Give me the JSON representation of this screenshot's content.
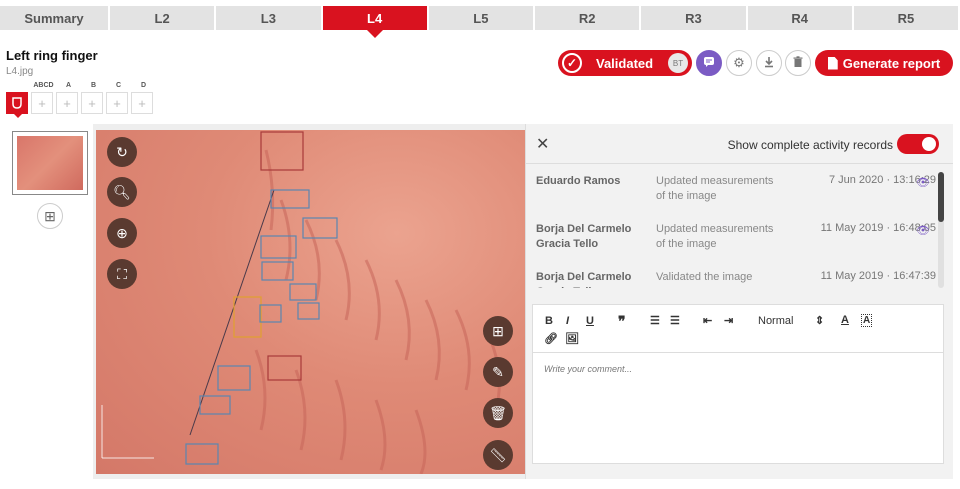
{
  "tabs": [
    "Summary",
    "L2",
    "L3",
    "L4",
    "L5",
    "R2",
    "R3",
    "R4",
    "R5"
  ],
  "active_tab": "L4",
  "finger": {
    "title": "Left ring finger",
    "filename": "L4.jpg"
  },
  "grid": {
    "labels": [
      "ABCD",
      "A",
      "B",
      "C",
      "D"
    ]
  },
  "status": {
    "label": "Validated",
    "initials": "BT"
  },
  "actions": {
    "generate_report": "Generate report"
  },
  "activity": {
    "show_label": "Show complete activity records",
    "records": [
      {
        "user": "Eduardo Ramos",
        "action": "Updated measurements of the image",
        "date": "7 Jun 2020 · 13:16:29"
      },
      {
        "user": "Borja Del Carmelo Gracia Tello",
        "action": "Updated measurements of the image",
        "date": "11 May 2019 · 16:48:05"
      },
      {
        "user": "Borja Del Carmelo Gracia Tello",
        "action": "Validated the image",
        "date": "11 May 2019 · 16:47:39"
      }
    ]
  },
  "editor": {
    "style_select": "Normal",
    "placeholder": "Write your comment..."
  },
  "colors": {
    "accent": "#d9121f",
    "purple": "#7b5bc4"
  }
}
